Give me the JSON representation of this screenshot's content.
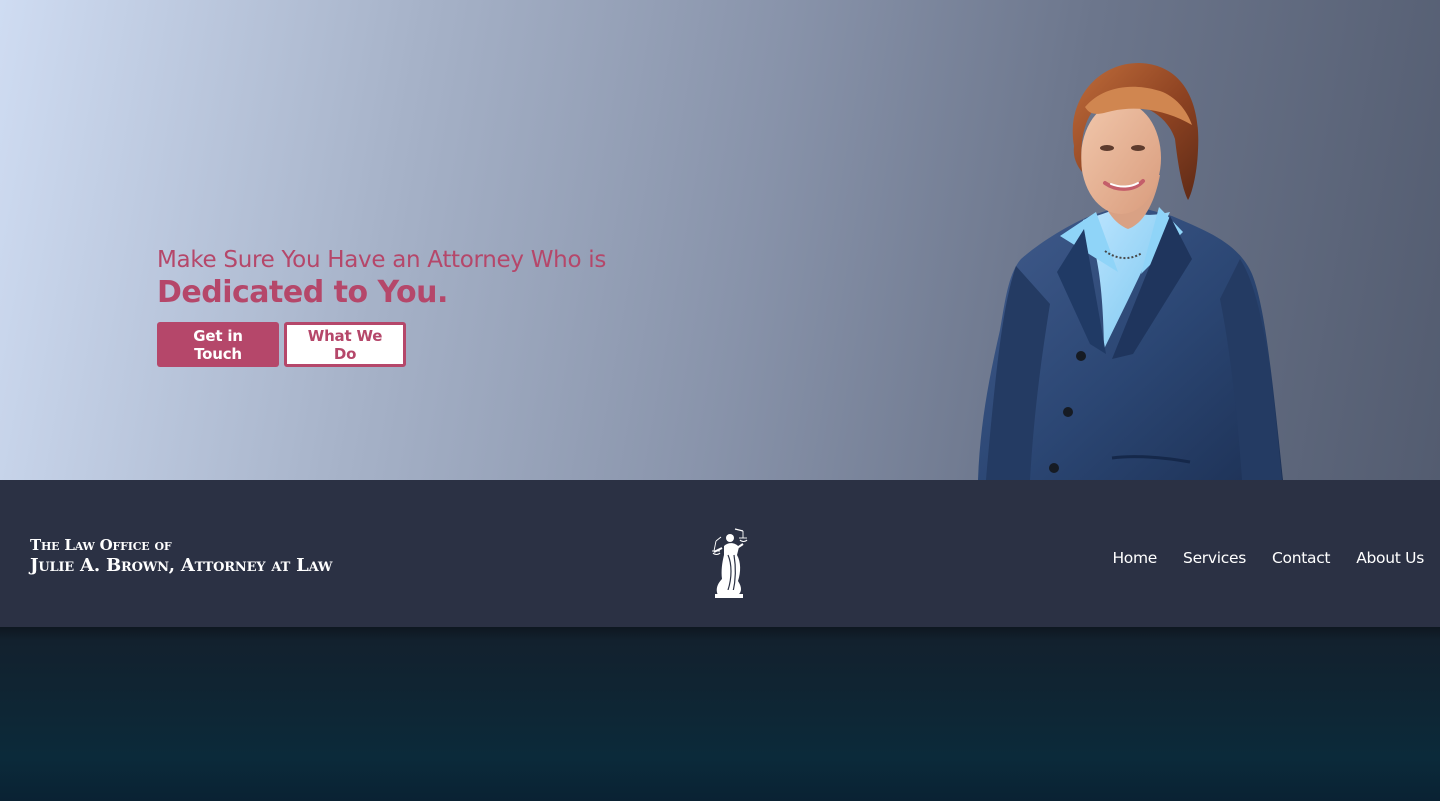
{
  "hero": {
    "line1": "Make Sure You Have an Attorney Who is",
    "line2": "Dedicated to You.",
    "primary_button": "Get in Touch",
    "secondary_button": "What We Do"
  },
  "header": {
    "firm_line1": "The Law Office of",
    "firm_line2": "Julie A. Brown, Attorney at Law"
  },
  "nav": {
    "items": [
      {
        "label": "Home"
      },
      {
        "label": "Services"
      },
      {
        "label": "Contact"
      },
      {
        "label": "About Us"
      }
    ]
  },
  "colors": {
    "accent": "#b5476a",
    "header_background": "#2b3144",
    "hero_gradient_left": "#cfdcf2",
    "hero_gradient_right": "#535c70",
    "text_on_dark": "#ffffff"
  },
  "icons": {
    "logo": "lady-justice-icon",
    "portrait": "attorney-portrait"
  }
}
